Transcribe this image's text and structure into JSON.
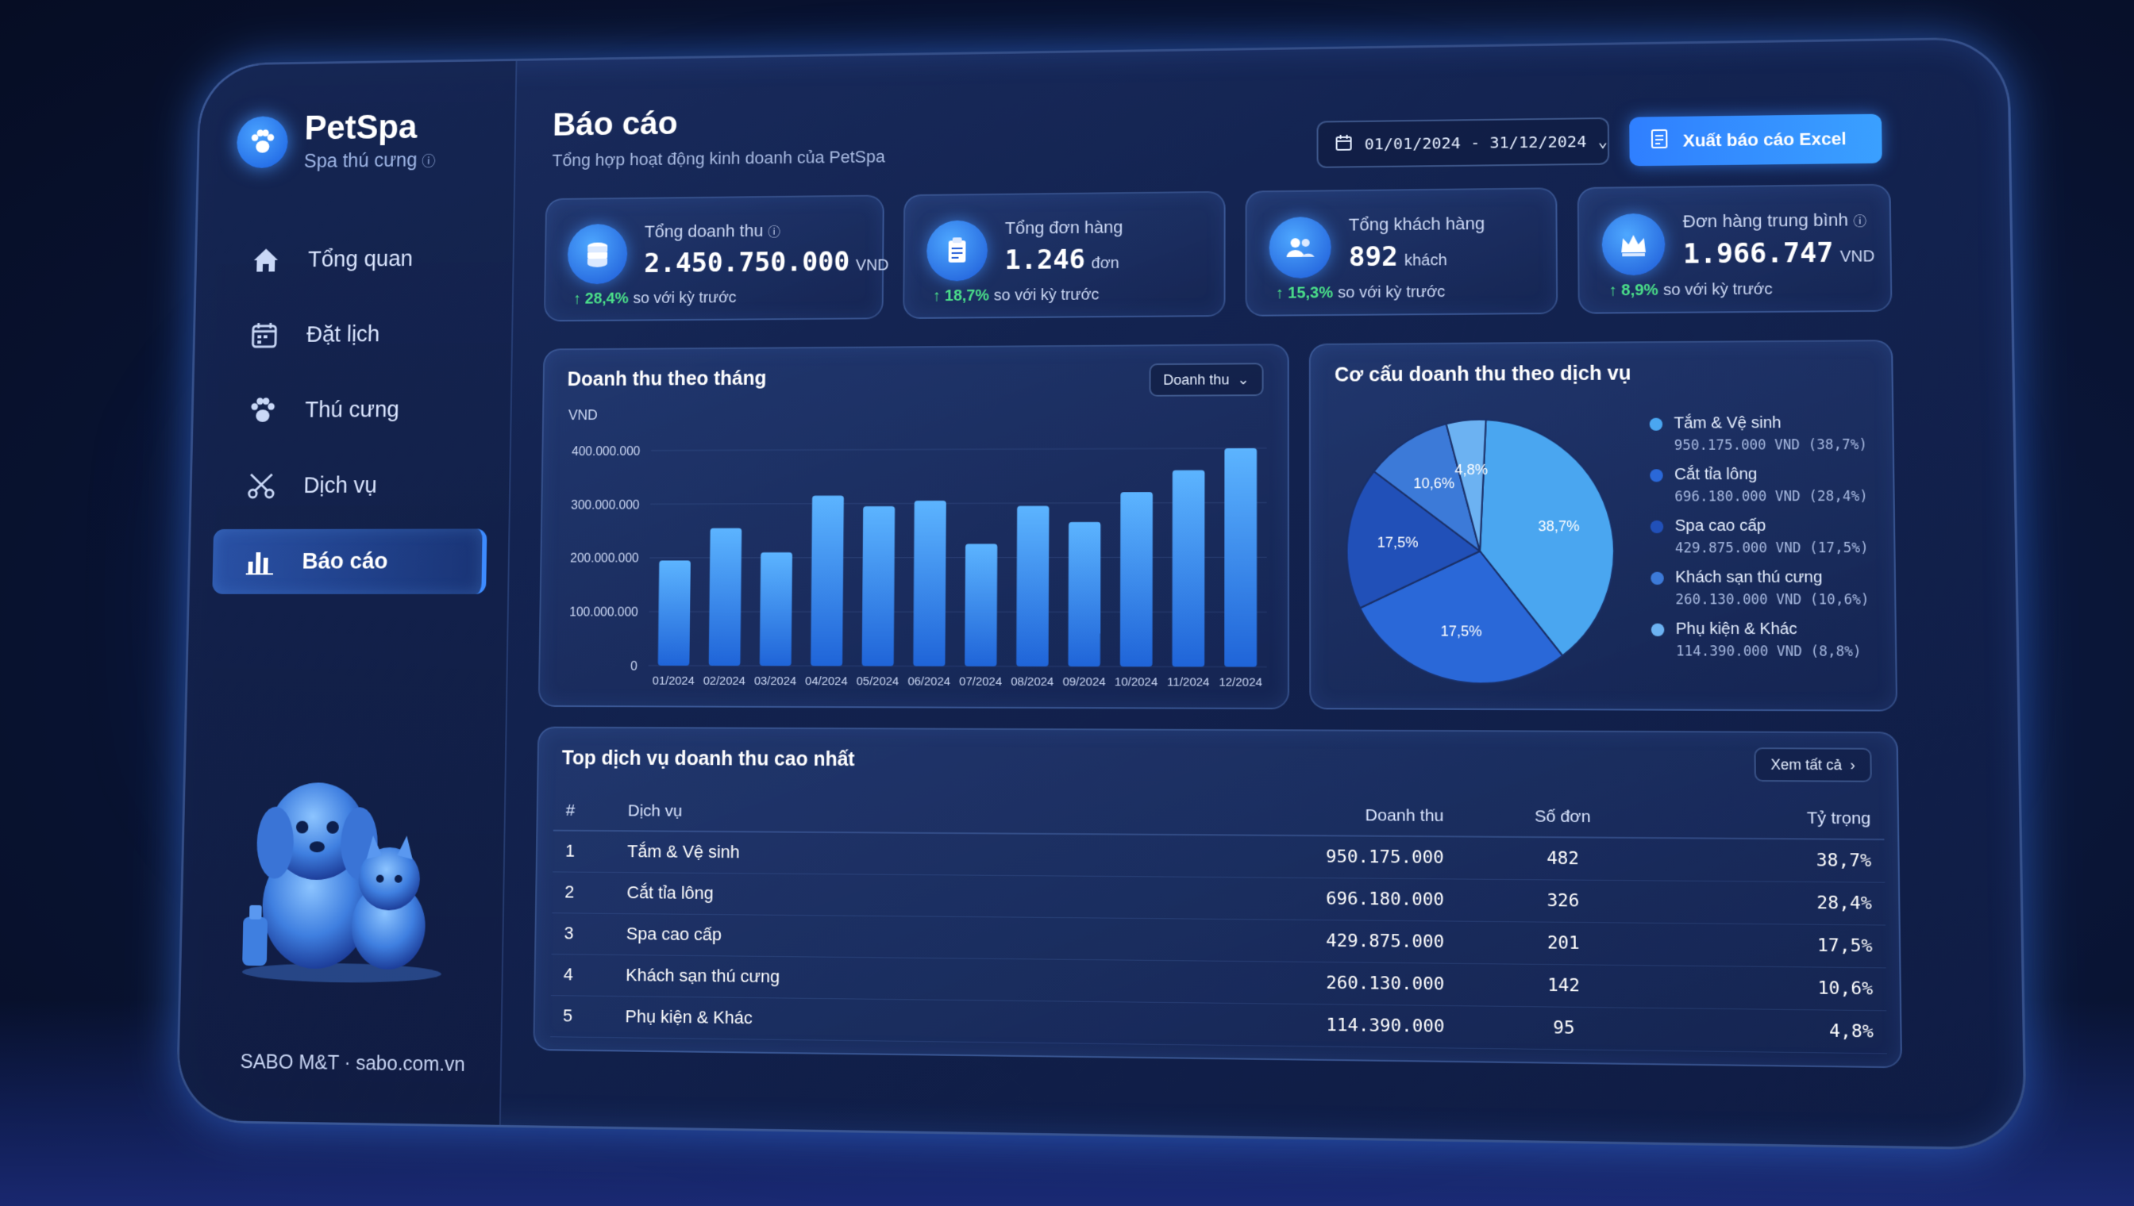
{
  "sidebar": {
    "brand_title": "PetSpa",
    "brand_sub": "Spa thú cưng",
    "items": [
      {
        "label": "Tổng quan",
        "icon": "home-icon"
      },
      {
        "label": "Đặt lịch",
        "icon": "calendar-icon"
      },
      {
        "label": "Thú cưng",
        "icon": "paw-icon"
      },
      {
        "label": "Dịch vụ",
        "icon": "scissors-icon"
      },
      {
        "label": "Báo cáo",
        "icon": "bar-chart-icon",
        "active": true
      }
    ],
    "footer": "SABO M&T · sabo.com.vn"
  },
  "header": {
    "title": "Báo cáo",
    "subtitle": "Tổng hợp hoạt động kinh doanh của PetSpa",
    "date_range": "01/01/2024 - 31/12/2024",
    "export_label": "Xuất báo cáo Excel"
  },
  "stats": [
    {
      "label": "Tổng doanh thu",
      "value": "2.450.750.000",
      "unit": "VND",
      "change": "28,4%",
      "change_text": "so với kỳ trước",
      "icon": "coins-icon"
    },
    {
      "label": "Tổng đơn hàng",
      "value": "1.246",
      "unit": "đơn",
      "change": "18,7%",
      "change_text": "so với kỳ trước",
      "icon": "clipboard-icon"
    },
    {
      "label": "Tổng khách hàng",
      "value": "892",
      "unit": "khách",
      "change": "15,3%",
      "change_text": "so với kỳ trước",
      "icon": "users-icon"
    },
    {
      "label": "Đơn hàng trung bình",
      "value": "1.966.747",
      "unit": "VND",
      "change": "8,9%",
      "change_text": "so với kỳ trước",
      "icon": "crown-icon"
    }
  ],
  "revenue_panel": {
    "title": "Doanh thu theo tháng",
    "dropdown": "Doanh thu"
  },
  "pie_panel": {
    "title": "Cơ cấu doanh thu theo dịch vụ"
  },
  "chart_data": [
    {
      "type": "bar",
      "title": "Doanh thu theo tháng",
      "ylabel": "VND",
      "ylim": [
        0,
        400000000
      ],
      "yticks": [
        "0",
        "100.000.000",
        "200.000.000",
        "300.000.000",
        "400.000.000"
      ],
      "categories": [
        "01/2024",
        "02/2024",
        "03/2024",
        "04/2024",
        "05/2024",
        "06/2024",
        "07/2024",
        "08/2024",
        "09/2024",
        "10/2024",
        "11/2024",
        "12/2024"
      ],
      "values": [
        195000000,
        255000000,
        210000000,
        315000000,
        295000000,
        305000000,
        225000000,
        295000000,
        265000000,
        320000000,
        360000000,
        400000000
      ],
      "color": "#3d95ff"
    },
    {
      "type": "pie",
      "title": "Cơ cấu doanh thu theo dịch vụ",
      "slices": [
        {
          "name": "Tắm & Vệ sinh",
          "value": 38.7,
          "label": "38,7%",
          "amount": "950.175.000 VND (38,7%)",
          "color": "#4aa6f0"
        },
        {
          "name": "Cắt tỉa lông",
          "value": 28.4,
          "label": "17,5%",
          "amount": "696.180.000 VND (28,4%)",
          "color": "#2a68d8"
        },
        {
          "name": "Spa cao cấp",
          "value": 17.5,
          "label": "17,5%",
          "amount": "429.875.000 VND (17,5%)",
          "color": "#2150b8"
        },
        {
          "name": "Khách sạn thú cưng",
          "value": 10.6,
          "label": "10,6%",
          "amount": "260.130.000 VND (10,6%)",
          "color": "#3c7ad8"
        },
        {
          "name": "Phụ kiện & Khác",
          "value": 4.8,
          "label": "4,8%",
          "amount": "114.390.000 VND (8,8%)",
          "color": "#6cb2f2"
        }
      ],
      "legend_placement": "right"
    }
  ],
  "top_services": {
    "title": "Top dịch vụ doanh thu cao nhất",
    "see_all": "Xem tất cả",
    "columns": [
      "#",
      "Dịch vụ",
      "Doanh thu",
      "Số đơn",
      "Tỷ trọng"
    ],
    "rows": [
      [
        "1",
        "Tắm & Vệ sinh",
        "950.175.000",
        "482",
        "38,7%"
      ],
      [
        "2",
        "Cắt tỉa lông",
        "696.180.000",
        "326",
        "28,4%"
      ],
      [
        "3",
        "Spa cao cấp",
        "429.875.000",
        "201",
        "17,5%"
      ],
      [
        "4",
        "Khách sạn thú cưng",
        "260.130.000",
        "142",
        "10,6%"
      ],
      [
        "5",
        "Phụ kiện & Khác",
        "114.390.000",
        "95",
        "4,8%"
      ]
    ]
  }
}
